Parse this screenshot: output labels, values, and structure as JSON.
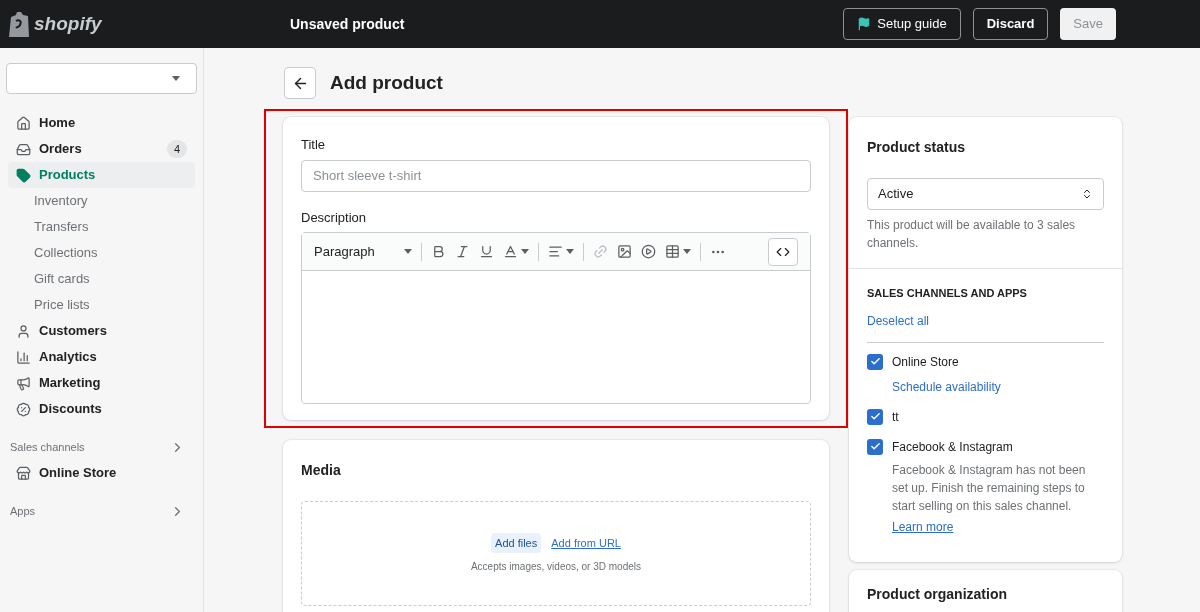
{
  "topbar": {
    "logo": "shopify",
    "title": "Unsaved product",
    "buttons": [
      {
        "kind": "guide",
        "label": "Setup guide"
      },
      {
        "kind": "secondary",
        "label": "Discard"
      },
      {
        "kind": "primary",
        "label": "Save",
        "disabled": true
      }
    ]
  },
  "sidebar": {
    "items": [
      {
        "kind": "main",
        "label": "Home",
        "selected": false
      },
      {
        "kind": "main",
        "label": "Orders",
        "badge": "4",
        "selected": false
      },
      {
        "kind": "main",
        "label": "Products",
        "selected": true
      },
      {
        "kind": "sub",
        "label": "Inventory",
        "selected": false
      },
      {
        "kind": "sub",
        "label": "Transfers",
        "selected": false
      },
      {
        "kind": "sub",
        "label": "Collections",
        "selected": false
      },
      {
        "kind": "sub",
        "label": "Gift cards",
        "selected": false
      },
      {
        "kind": "sub",
        "label": "Price lists",
        "selected": false
      },
      {
        "kind": "main",
        "label": "Customers",
        "selected": false
      },
      {
        "kind": "main",
        "label": "Analytics",
        "selected": false
      },
      {
        "kind": "main",
        "label": "Marketing",
        "selected": false
      },
      {
        "kind": "main",
        "label": "Discounts",
        "selected": false
      },
      {
        "kind": "section",
        "label": "Sales channels"
      },
      {
        "kind": "main",
        "label": "Online Store",
        "selected": false
      },
      {
        "kind": "section",
        "label": "Apps"
      }
    ]
  },
  "page": {
    "title": "Add product"
  },
  "product_card": {
    "highlighted": true,
    "title_label": "Title",
    "title_placeholder": "Short sleeve t-shirt",
    "description_label": "Description",
    "format_select": "Paragraph"
  },
  "media_card": {
    "title": "Media",
    "add_files": "Add files",
    "add_url": "Add from URL",
    "hint": "Accepts images, videos, or 3D models"
  },
  "status_card": {
    "title": "Product status",
    "status": "Active",
    "note": "This product will be available to 3 sales channels.",
    "channels_heading": "SALES CHANNELS AND APPS",
    "deselect": "Deselect all",
    "channels": [
      {
        "label": "Online Store",
        "checked": true,
        "link": "Schedule availability"
      },
      {
        "label": "tt",
        "checked": true
      },
      {
        "label": "Facebook & Instagram",
        "checked": true,
        "note": "Facebook & Instagram has not been set up. Finish the remaining steps to start selling on this sales channel.",
        "note_link": "Learn more"
      }
    ]
  },
  "organization_card": {
    "title": "Product organization"
  }
}
